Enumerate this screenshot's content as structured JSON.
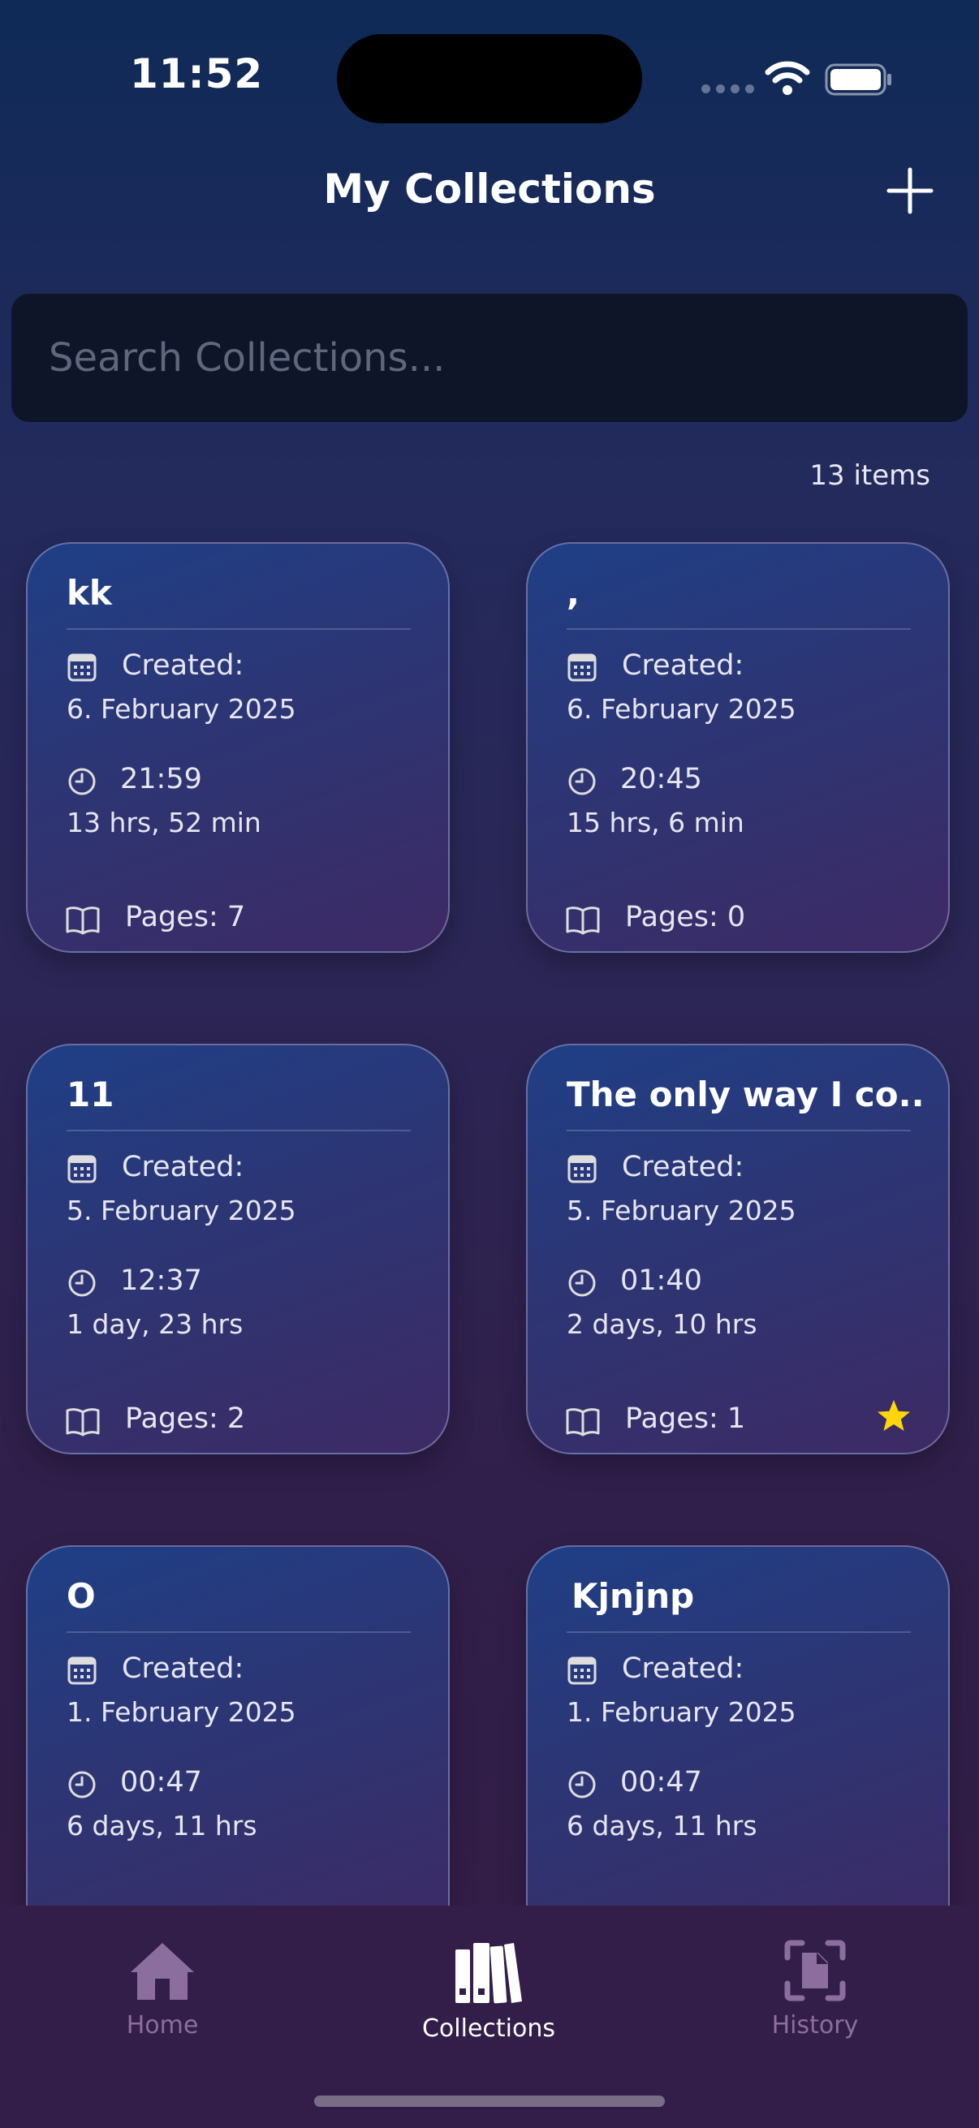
{
  "status_bar": {
    "time": "11:52"
  },
  "header": {
    "title": "My Collections"
  },
  "search": {
    "placeholder": "Search Collections..."
  },
  "item_count": "13 items",
  "created_label": "Created:",
  "collections": [
    {
      "title": "kk",
      "created_date": "6. February 2025",
      "time": "21:59",
      "age": "13 hrs, 52 min",
      "pages": "Pages: 7",
      "favorite": false
    },
    {
      "title": ",",
      "created_date": "6. February 2025",
      "time": "20:45",
      "age": "15 hrs, 6 min",
      "pages": "Pages: 0",
      "favorite": false
    },
    {
      "title": "11",
      "created_date": "5. February 2025",
      "time": "12:37",
      "age": "1 day, 23 hrs",
      "pages": "Pages: 2",
      "favorite": false
    },
    {
      "title": "The only way I co...",
      "created_date": "5. February 2025",
      "time": "01:40",
      "age": "2 days, 10 hrs",
      "pages": "Pages: 1",
      "favorite": true
    },
    {
      "title": "O",
      "created_date": "1. February 2025",
      "time": "00:47",
      "age": "6 days, 11 hrs"
    },
    {
      "title": "Kjnjnp",
      "created_date": "1. February 2025",
      "time": "00:47",
      "age": "6 days, 11 hrs"
    }
  ],
  "tabs": [
    {
      "label": "Home",
      "icon": "home-icon",
      "active": false
    },
    {
      "label": "Collections",
      "icon": "books-icon",
      "active": true
    },
    {
      "label": "History",
      "icon": "scan-document-icon",
      "active": false
    }
  ],
  "colors": {
    "star": "#ffd60a",
    "tab_inactive": "#8c6e9e",
    "tab_active": "#ffffff"
  }
}
